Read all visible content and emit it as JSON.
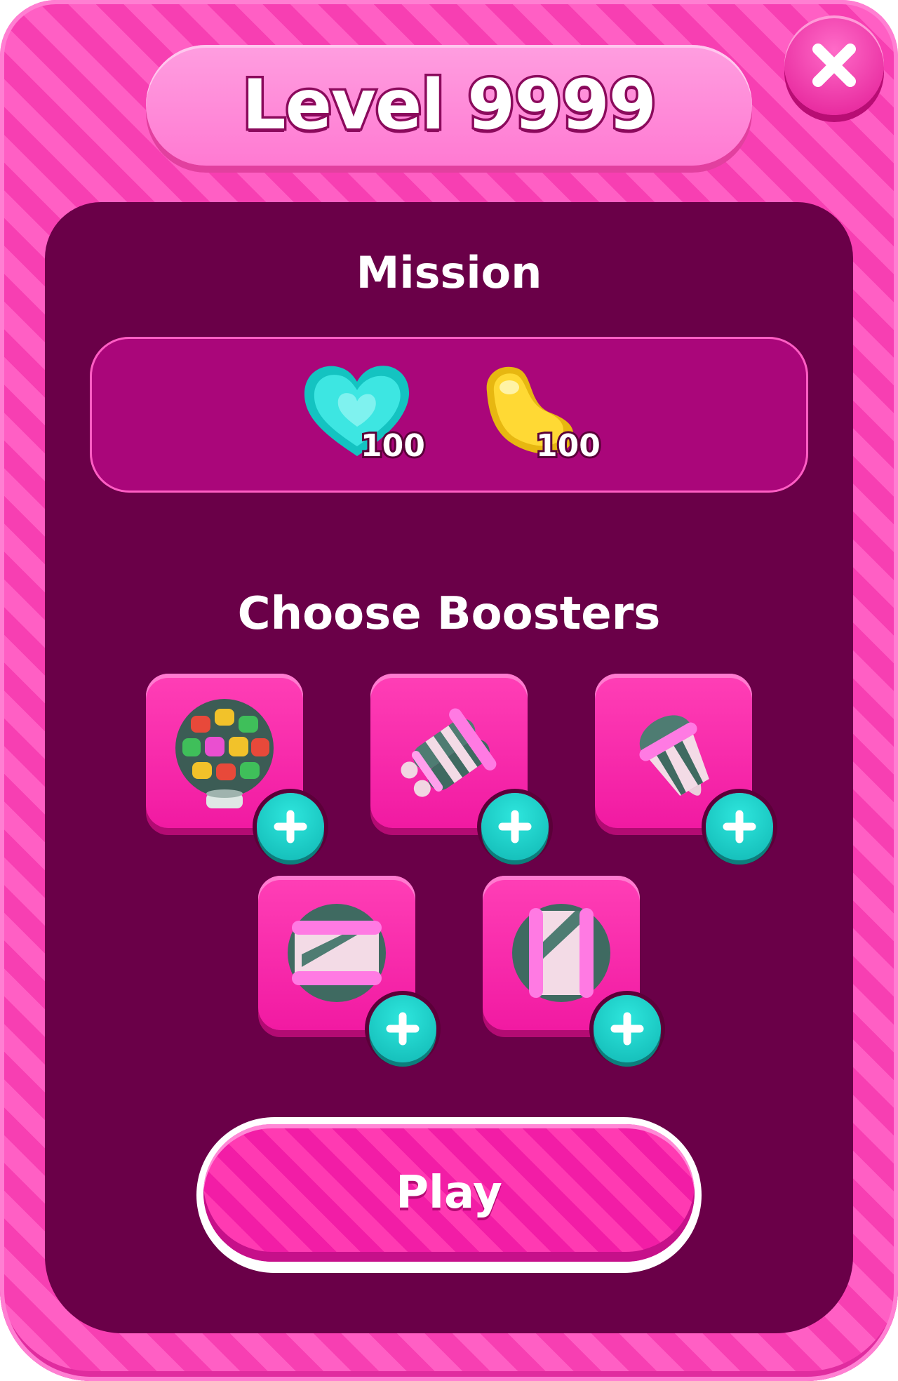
{
  "header": {
    "title": "Level 9999"
  },
  "mission": {
    "heading": "Mission",
    "items": [
      {
        "icon": "cyan-heart-candy-icon",
        "count": "100"
      },
      {
        "icon": "yellow-jelly-candy-icon",
        "count": "100"
      }
    ]
  },
  "boosters": {
    "heading": "Choose Boosters",
    "items": [
      {
        "icon": "color-bomb-booster-icon"
      },
      {
        "icon": "double-rocket-booster-icon"
      },
      {
        "icon": "striped-rocket-booster-icon"
      },
      {
        "icon": "horizontal-striped-booster-icon"
      },
      {
        "icon": "vertical-striped-booster-icon"
      }
    ]
  },
  "play": {
    "label": "Play"
  },
  "colors": {
    "frame": "#f73fb2",
    "panel": "#6a0048",
    "accent": "#10b7b3"
  }
}
